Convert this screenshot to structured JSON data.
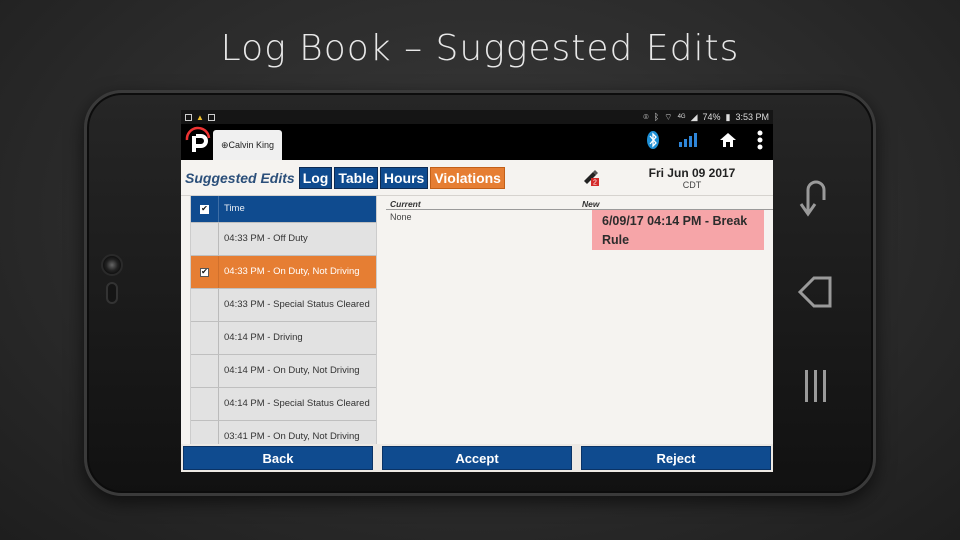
{
  "slide": {
    "title": "Log Book – Suggested Edits"
  },
  "status_bar": {
    "battery": "74%",
    "time": "3:53 PM",
    "network": "4G",
    "icons": [
      "image-icon",
      "warning-icon",
      "copy-icon",
      "location-icon",
      "bluetooth-icon",
      "wifi-icon",
      "signal-icon",
      "battery-icon"
    ]
  },
  "app_bar": {
    "driver_tab": "⊕Calvin King",
    "icons": [
      "bluetooth-icon",
      "signal-icon",
      "home-icon",
      "more-vert-icon"
    ],
    "colors": {
      "bluetooth": "#1e90d6",
      "signal": "#2f86d8"
    }
  },
  "toolbar": {
    "title": "Suggested Edits",
    "buttons": [
      "Log",
      "Table",
      "Hours",
      "Violations"
    ],
    "badge": "2",
    "date": "Fri Jun 09 2017",
    "timezone": "CDT"
  },
  "list": {
    "header": "Time",
    "rows": [
      {
        "label": "04:33 PM - Off Duty",
        "checked": false,
        "selected": false
      },
      {
        "label": "04:33 PM - On Duty, Not Driving",
        "checked": true,
        "selected": true
      },
      {
        "label": "04:33 PM - Special Status Cleared",
        "checked": false,
        "selected": false
      },
      {
        "label": "04:14 PM - Driving",
        "checked": false,
        "selected": false
      },
      {
        "label": "04:14 PM - On Duty, Not Driving",
        "checked": false,
        "selected": false
      },
      {
        "label": "04:14 PM - Special Status Cleared",
        "checked": false,
        "selected": false
      },
      {
        "label": "03:41 PM - On Duty, Not Driving",
        "checked": false,
        "selected": false
      }
    ]
  },
  "compare": {
    "current_label": "Current",
    "new_label": "New",
    "current_value": "None",
    "new_value": "6/09/17 04:14 PM - Break Rule"
  },
  "actions": {
    "back": "Back",
    "accept": "Accept",
    "reject": "Reject"
  },
  "colors": {
    "primary": "#0f4b8f",
    "accent": "#e67e33",
    "highlight": "#f6a5a8"
  }
}
